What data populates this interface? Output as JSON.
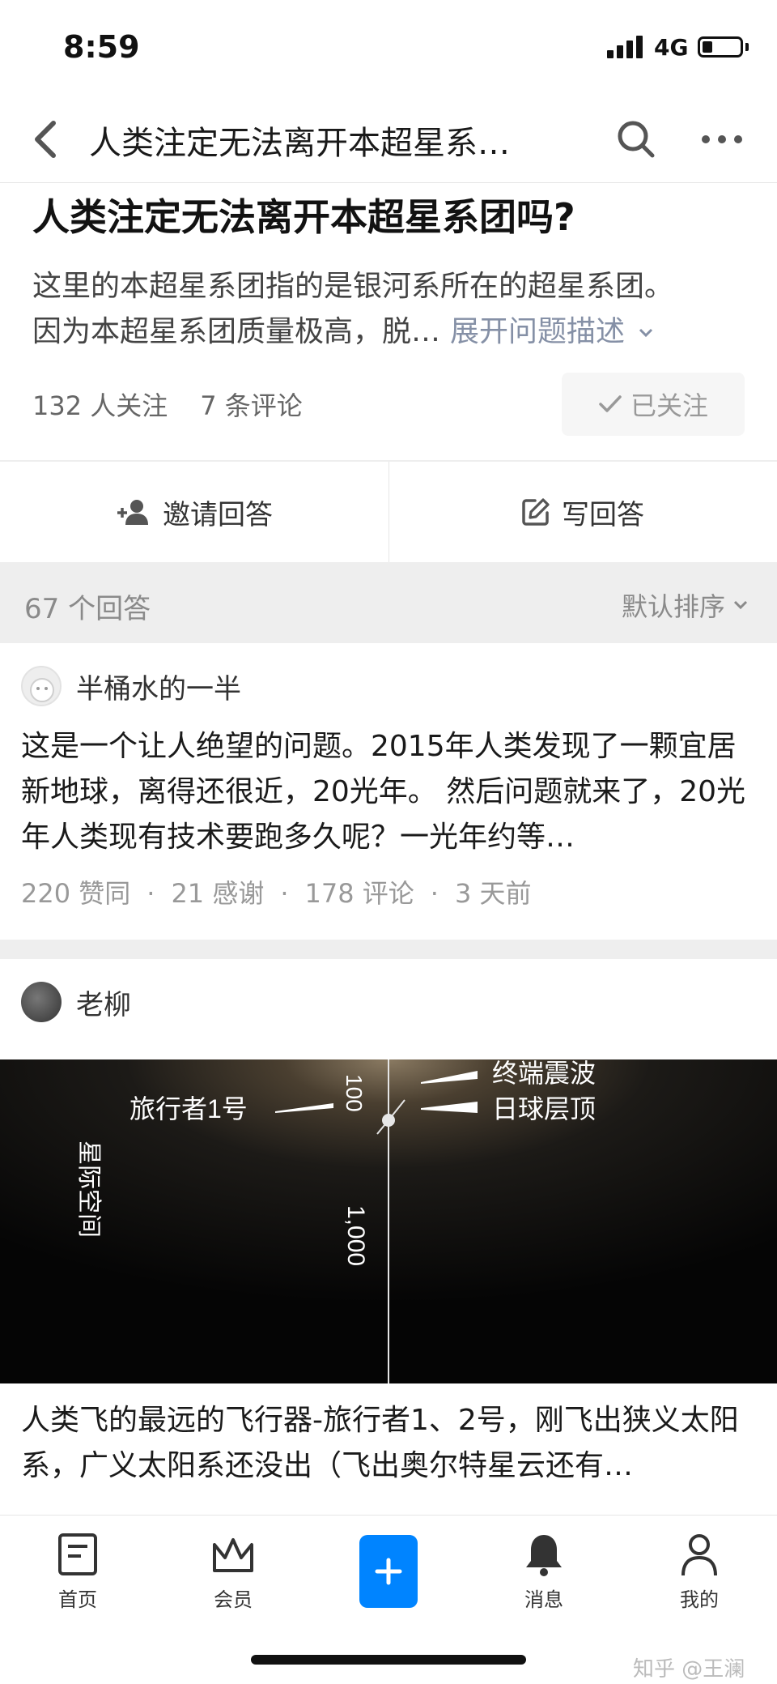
{
  "status_bar": {
    "time": "8:59",
    "network": "4G"
  },
  "nav": {
    "title": "人类注定无法离开本超星系…"
  },
  "question": {
    "title": "人类注定无法离开本超星系团吗?",
    "desc_line1": "这里的本超星系团指的是银河系所在的超星系团。",
    "desc_line2": "因为本超星系团质量极高，脱…",
    "expand_label": "展开问题描述",
    "followers": "132 人关注",
    "comments": "7 条评论",
    "follow_label": "已关注"
  },
  "actions": {
    "invite_label": "邀请回答",
    "write_label": "写回答"
  },
  "answers_bar": {
    "count": "67 个回答",
    "sort_label": "默认排序"
  },
  "answers": [
    {
      "author": "半桶水的一半",
      "text": "这是一个让人绝望的问题。2015年人类发现了一颗宜居新地球，离得还很近，20光年。 然后问题就来了，20光年人类现有技术要跑多久呢？一光年约等…",
      "likes": "220 赞同",
      "thanks": "21 感谢",
      "comments": "178 评论",
      "time": "3 天前"
    },
    {
      "author": "老柳",
      "image_labels": {
        "termination_shock": "终端震波",
        "heliopause": "日球层顶",
        "voyager": "旅行者1号",
        "interstellar": "星际空间",
        "au_100": "100",
        "au_1000": "1,000"
      },
      "text": "人类飞的最远的飞行器-旅行者1、2号，刚飞出狭义太阳系，广义太阳系还没出（飞出奥尔特星云还有…"
    }
  ],
  "bottom_nav": {
    "home": "首页",
    "vip": "会员",
    "messages": "消息",
    "me": "我的"
  },
  "watermark": "知乎 @王澜",
  "colors": {
    "accent": "#0084ff",
    "muted": "#8590a6"
  }
}
